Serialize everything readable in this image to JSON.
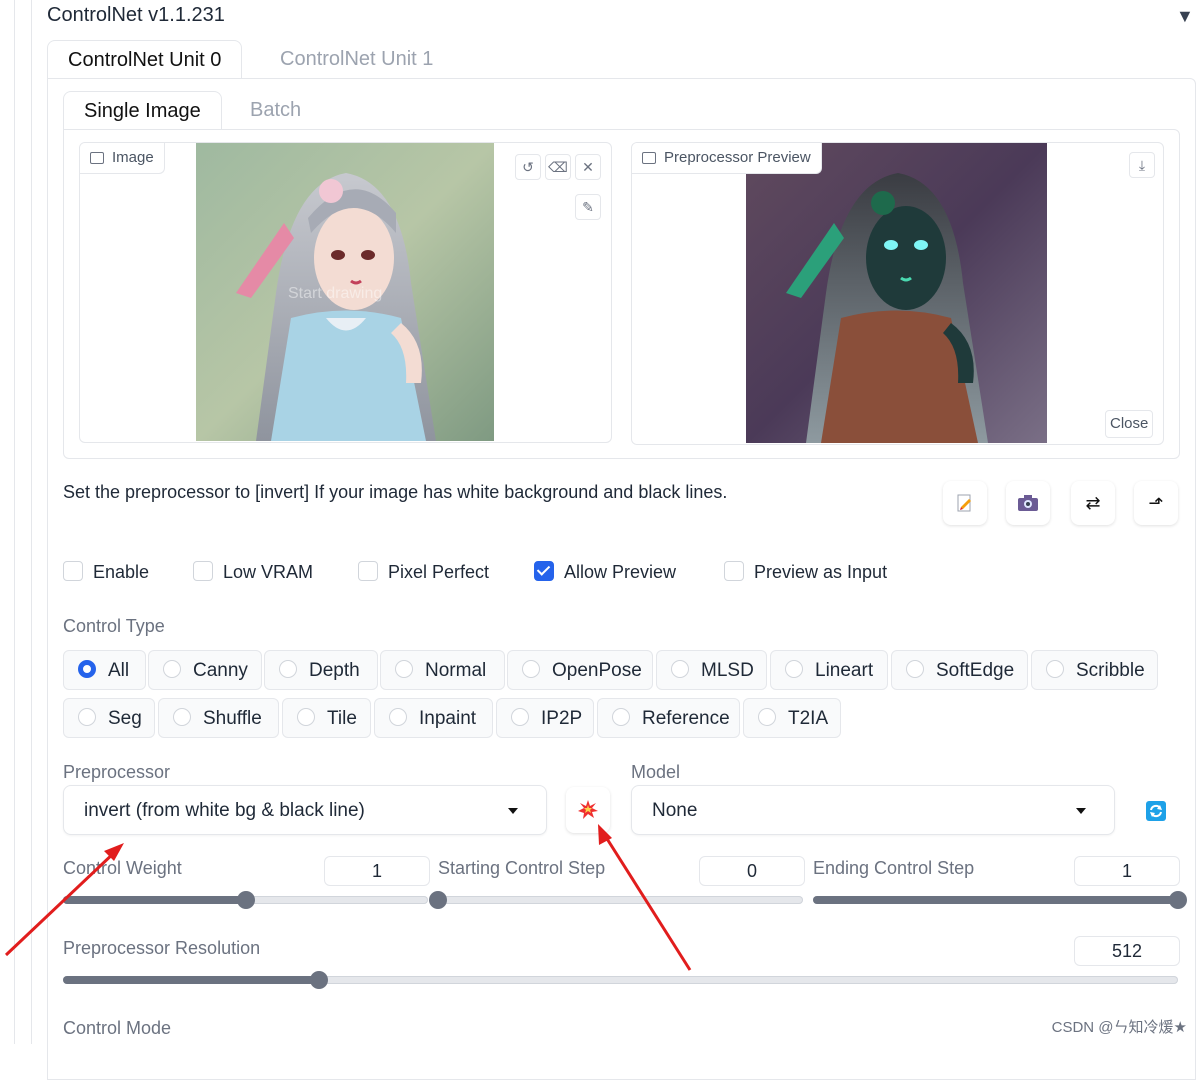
{
  "header": {
    "title": "ControlNet v1.1.231",
    "collapse_icon": "triangle-down-icon"
  },
  "unit_tabs": [
    {
      "label": "ControlNet Unit 0",
      "active": true
    },
    {
      "label": "ControlNet Unit 1",
      "active": false
    }
  ],
  "mode_tabs": [
    {
      "label": "Single Image",
      "active": true
    },
    {
      "label": "Batch",
      "active": false
    }
  ],
  "image_panel": {
    "label": "Image",
    "overlay_text": "Start drawing",
    "buttons": [
      "undo-icon",
      "eraser-icon",
      "close-icon",
      "brush-icon"
    ]
  },
  "preview_panel": {
    "label": "Preprocessor Preview",
    "download_icon": "download-icon",
    "close_label": "Close"
  },
  "hint": "Set the preprocessor to [invert] If your image has white background and black lines.",
  "toolbar_icons": [
    "edit-icon",
    "camera-icon",
    "swap-icon",
    "send-dimensions-icon"
  ],
  "checkboxes": [
    {
      "label": "Enable",
      "checked": false
    },
    {
      "label": "Low VRAM",
      "checked": false
    },
    {
      "label": "Pixel Perfect",
      "checked": false
    },
    {
      "label": "Allow Preview",
      "checked": true
    },
    {
      "label": "Preview as Input",
      "checked": false
    }
  ],
  "control_type": {
    "label": "Control Type",
    "options": [
      "All",
      "Canny",
      "Depth",
      "Normal",
      "OpenPose",
      "MLSD",
      "Lineart",
      "SoftEdge",
      "Scribble",
      "Seg",
      "Shuffle",
      "Tile",
      "Inpaint",
      "IP2P",
      "Reference",
      "T2IA"
    ],
    "selected": "All"
  },
  "preprocessor": {
    "label": "Preprocessor",
    "value": "invert (from white bg & black line)",
    "run_icon": "explosion-icon"
  },
  "model": {
    "label": "Model",
    "value": "None",
    "refresh_icon": "refresh-icon"
  },
  "sliders": {
    "control_weight": {
      "label": "Control Weight",
      "value": "1",
      "fraction": 0.5
    },
    "starting_step": {
      "label": "Starting Control Step",
      "value": "0",
      "fraction": 0.0
    },
    "ending_step": {
      "label": "Ending Control Step",
      "value": "1",
      "fraction": 1.0
    },
    "resolution": {
      "label": "Preprocessor Resolution",
      "value": "512",
      "fraction": 0.23
    }
  },
  "control_mode": {
    "label": "Control Mode"
  },
  "watermark": "CSDN @ㄣ知冷煖★",
  "colors": {
    "accent": "#2563eb",
    "arrow": "#e11d1d"
  }
}
